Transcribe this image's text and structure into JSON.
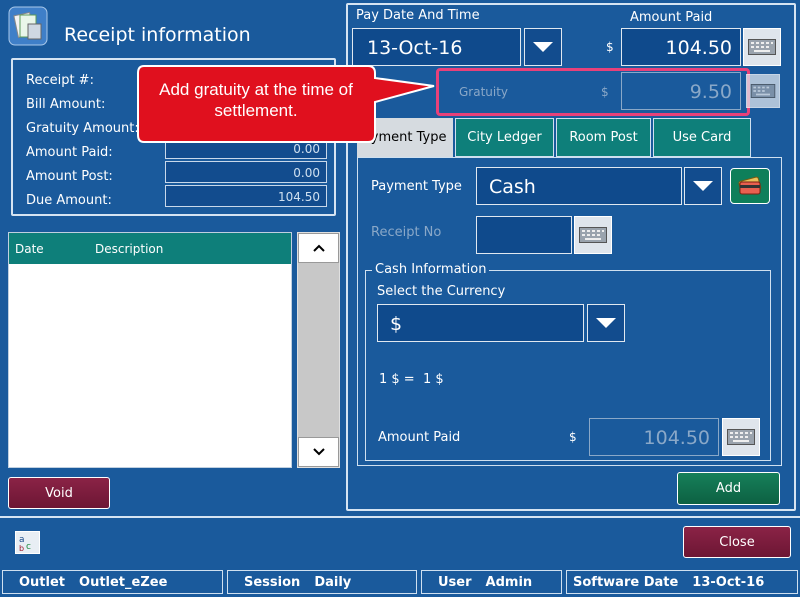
{
  "window": {
    "title": "Receipt information"
  },
  "receipt": {
    "rows": [
      {
        "label": "Receipt #:",
        "value": ""
      },
      {
        "label": "Bill Amount:",
        "value": ""
      },
      {
        "label": "Gratuity Amount:",
        "value": ""
      },
      {
        "label": "Amount Paid:",
        "value": "0.00"
      },
      {
        "label": "Amount Post:",
        "value": "0.00"
      },
      {
        "label": "Due Amount:",
        "value": "104.50"
      }
    ]
  },
  "history": {
    "col_date": "Date",
    "col_description": "Description"
  },
  "buttons": {
    "void": "Void",
    "add": "Add",
    "close": "Close"
  },
  "payment": {
    "pay_date_label": "Pay Date And Time",
    "pay_date_value": "13-Oct-16",
    "amount_paid_label": "Amount Paid",
    "currency_symbol": "$",
    "amount_paid_value": "104.50",
    "gratuity_label": "Gratuity",
    "gratuity_value": "9.50"
  },
  "callout": {
    "text": "Add gratuity at the time of settlement."
  },
  "tabs": [
    "Payment Type",
    "City Ledger",
    "Room Post",
    "Use Card"
  ],
  "payment_type": {
    "label": "Payment Type",
    "value": "Cash",
    "receipt_no_label": "Receipt No",
    "receipt_no_value": ""
  },
  "cash_info": {
    "legend": "Cash Information",
    "currency_label": "Select the Currency",
    "currency_value": "$",
    "rate_text": "1 $ =  1 $",
    "amount_label": "Amount Paid",
    "amount_symbol": "$",
    "amount_value": "104.50"
  },
  "status_bar": {
    "outlet_label": "Outlet",
    "outlet_value": "Outlet_eZee",
    "session_label": "Session",
    "session_value": "Daily",
    "user_label": "User",
    "user_value": "Admin",
    "software_date_label": "Software Date",
    "software_date_value": "13-Oct-16"
  },
  "colors": {
    "background": "#1a5a9c",
    "teal": "#0e7f7a",
    "callout": "#e0101e",
    "highlight": "#e8417a"
  }
}
